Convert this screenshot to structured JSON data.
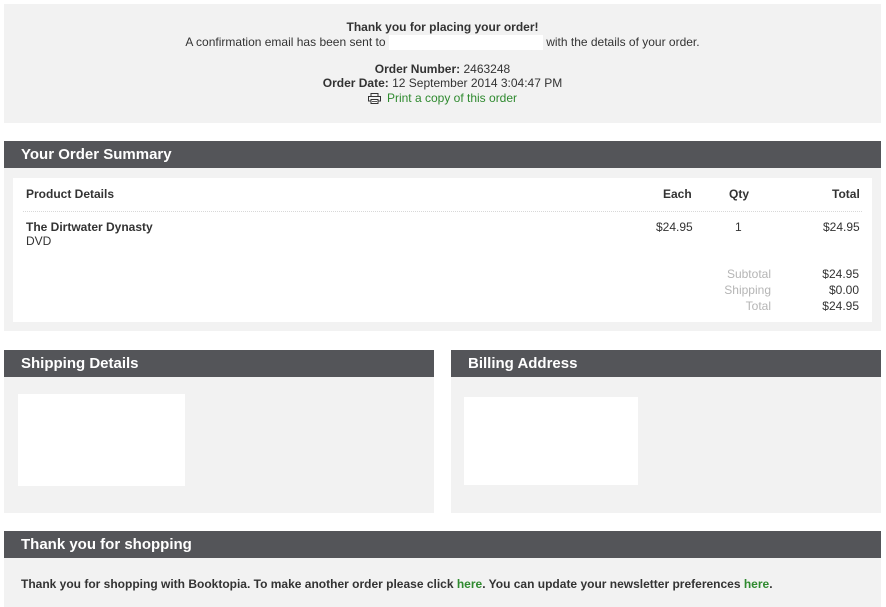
{
  "confirmation": {
    "title": "Thank you for placing your order!",
    "email_prefix": "A confirmation email has been sent to",
    "email_suffix": "with the details of your order.",
    "order_number_label": "Order Number:",
    "order_number": "2463248",
    "order_date_label": "Order Date:",
    "order_date": "12 September 2014 3:04:47 PM",
    "print_link": "Print a copy of this order",
    "print_icon": "printer-icon"
  },
  "order_summary": {
    "heading": "Your Order Summary",
    "columns": {
      "product": "Product Details",
      "each": "Each",
      "qty": "Qty",
      "total": "Total"
    },
    "items": [
      {
        "title": "The Dirtwater Dynasty",
        "format": "DVD",
        "each": "$24.95",
        "qty": "1",
        "total": "$24.95"
      }
    ],
    "totals": {
      "subtotal_label": "Subtotal",
      "subtotal": "$24.95",
      "shipping_label": "Shipping",
      "shipping": "$0.00",
      "total_label": "Total",
      "total": "$24.95"
    }
  },
  "shipping": {
    "heading": "Shipping Details"
  },
  "billing": {
    "heading": "Billing Address"
  },
  "thanks": {
    "heading": "Thank you for shopping",
    "text_1": "Thank you for shopping with Booktopia. To make another order please click ",
    "link_1": "here",
    "text_2": ". You can update your newsletter preferences ",
    "link_2": "here",
    "text_3": "."
  },
  "colors": {
    "header_bg": "#545559",
    "panel_bg": "#f2f2f2",
    "link": "#2f8a2f"
  }
}
